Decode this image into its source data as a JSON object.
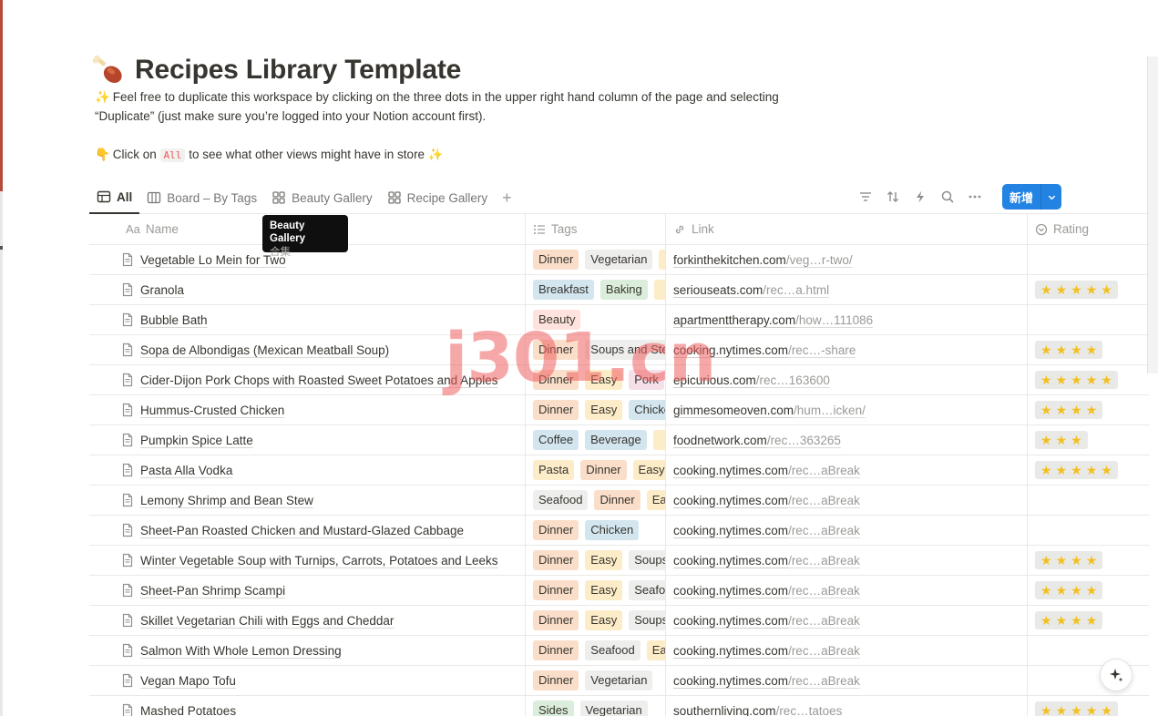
{
  "page": {
    "title": "Recipes Library Template",
    "desc_line1_emoji": "✨",
    "desc_line1": "Feel free to duplicate this workspace by clicking on the three dots in the upper right hand column of the page and selecting",
    "desc_line2": "“Duplicate” (just make sure you’re logged into your Notion account first).",
    "desc_line3_emoji": "👇",
    "desc_line3_pre": "Click on",
    "desc_line3_code": "All",
    "desc_line3_post": "to see what other views might have in store",
    "desc_line3_emoji_end": "✨"
  },
  "tabs": [
    {
      "label": "All",
      "icon": "table-icon",
      "active": true
    },
    {
      "label": "Board – By Tags",
      "icon": "board-icon",
      "active": false
    },
    {
      "label": "Beauty Gallery",
      "icon": "gallery-icon",
      "active": false
    },
    {
      "label": "Recipe Gallery",
      "icon": "gallery-icon",
      "active": false
    }
  ],
  "toolbar": {
    "icons": [
      "filter-icon",
      "sort-icon",
      "automation-icon",
      "search-icon",
      "more-icon"
    ],
    "new_button": "新增"
  },
  "tooltip": {
    "title": "Beauty Gallery",
    "subtitle": "合集"
  },
  "columns": {
    "name_prefix": "Aa",
    "name": "Name",
    "tags": "Tags",
    "link": "Link",
    "rating": "Rating"
  },
  "tag_colors": {
    "Dinner": "#fadec9",
    "Vegetarian": "#eeeeed",
    "Breakfast": "#d3e5ef",
    "Baking": "#dbeddb",
    "Beauty": "#ffe2dd",
    "Soups and Stews": "#eeeeed",
    "Easy": "#fdecc8",
    "Pork": "#f5e0e9",
    "Chicken": "#d3e5ef",
    "Coffee": "#d3e5ef",
    "Beverage": "#d3e5ef",
    "Pasta": "#fdecc8",
    "Seafood": "#eeeeed",
    "Sides": "#dbeddb",
    "Extra": "#fdecc8"
  },
  "rows": [
    {
      "name": "Vegetable Lo Mein for Two",
      "tags": [
        "Dinner",
        "Vegetarian",
        ""
      ],
      "link_domain": "forkinthekitchen.com",
      "link_path": "/veg…r-two/",
      "rating": 0
    },
    {
      "name": "Granola",
      "tags": [
        "Breakfast",
        "Baking",
        ""
      ],
      "link_domain": "seriouseats.com",
      "link_path": "/rec…a.html",
      "rating": 5
    },
    {
      "name": "Bubble Bath",
      "tags": [
        "Beauty"
      ],
      "link_domain": "apartmenttherapy.com",
      "link_path": "/how…111086",
      "rating": 0
    },
    {
      "name": "Sopa de Albondigas (Mexican Meatball Soup)",
      "tags": [
        "Dinner",
        "Soups and Stews"
      ],
      "link_domain": "cooking.nytimes.com",
      "link_path": "/rec…-share",
      "rating": 4
    },
    {
      "name": "Cider-Dijon Pork Chops with Roasted Sweet Potatoes and Apples",
      "tags": [
        "Dinner",
        "Easy",
        "Pork"
      ],
      "link_domain": "epicurious.com",
      "link_path": "/rec…163600",
      "rating": 5
    },
    {
      "name": "Hummus-Crusted Chicken",
      "tags": [
        "Dinner",
        "Easy",
        "Chicken"
      ],
      "link_domain": "gimmesomeoven.com",
      "link_path": "/hum…icken/",
      "rating": 4
    },
    {
      "name": "Pumpkin Spice Latte",
      "tags": [
        "Coffee",
        "Beverage",
        ""
      ],
      "link_domain": "foodnetwork.com",
      "link_path": "/rec…363265",
      "rating": 3
    },
    {
      "name": "Pasta Alla Vodka",
      "tags": [
        "Pasta",
        "Dinner",
        "Easy"
      ],
      "link_domain": "cooking.nytimes.com",
      "link_path": "/rec…aBreak",
      "rating": 5
    },
    {
      "name": "Lemony Shrimp and Bean Stew",
      "tags": [
        "Seafood",
        "Dinner",
        "Easy"
      ],
      "link_domain": "cooking.nytimes.com",
      "link_path": "/rec…aBreak",
      "rating": 0
    },
    {
      "name": "Sheet-Pan Roasted Chicken and Mustard-Glazed Cabbage",
      "tags": [
        "Dinner",
        "Chicken"
      ],
      "link_domain": "cooking.nytimes.com",
      "link_path": "/rec…aBreak",
      "rating": 0
    },
    {
      "name": "Winter Vegetable Soup with Turnips, Carrots, Potatoes and Leeks",
      "tags": [
        "Dinner",
        "Easy",
        "Soups and Stews"
      ],
      "link_domain": "cooking.nytimes.com",
      "link_path": "/rec…aBreak",
      "rating": 4
    },
    {
      "name": "Sheet-Pan Shrimp Scampi",
      "tags": [
        "Dinner",
        "Easy",
        "Seafood"
      ],
      "link_domain": "cooking.nytimes.com",
      "link_path": "/rec…aBreak",
      "rating": 4
    },
    {
      "name": "Skillet Vegetarian Chili with Eggs and Cheddar",
      "tags": [
        "Dinner",
        "Easy",
        "Soups and Stews"
      ],
      "link_domain": "cooking.nytimes.com",
      "link_path": "/rec…aBreak",
      "rating": 4
    },
    {
      "name": "Salmon With Whole Lemon Dressing",
      "tags": [
        "Dinner",
        "Seafood",
        "Easy"
      ],
      "link_domain": "cooking.nytimes.com",
      "link_path": "/rec…aBreak",
      "rating": 0
    },
    {
      "name": "Vegan Mapo Tofu",
      "tags": [
        "Dinner",
        "Vegetarian"
      ],
      "link_domain": "cooking.nytimes.com",
      "link_path": "/rec…aBreak",
      "rating": 0
    },
    {
      "name": "Mashed Potatoes",
      "tags": [
        "Sides",
        "Vegetarian"
      ],
      "link_domain": "southernliving.com",
      "link_path": "/rec…tatoes",
      "rating": 5
    }
  ],
  "watermark": "j301.cn",
  "ai_button_icon": "sparkle-icon"
}
